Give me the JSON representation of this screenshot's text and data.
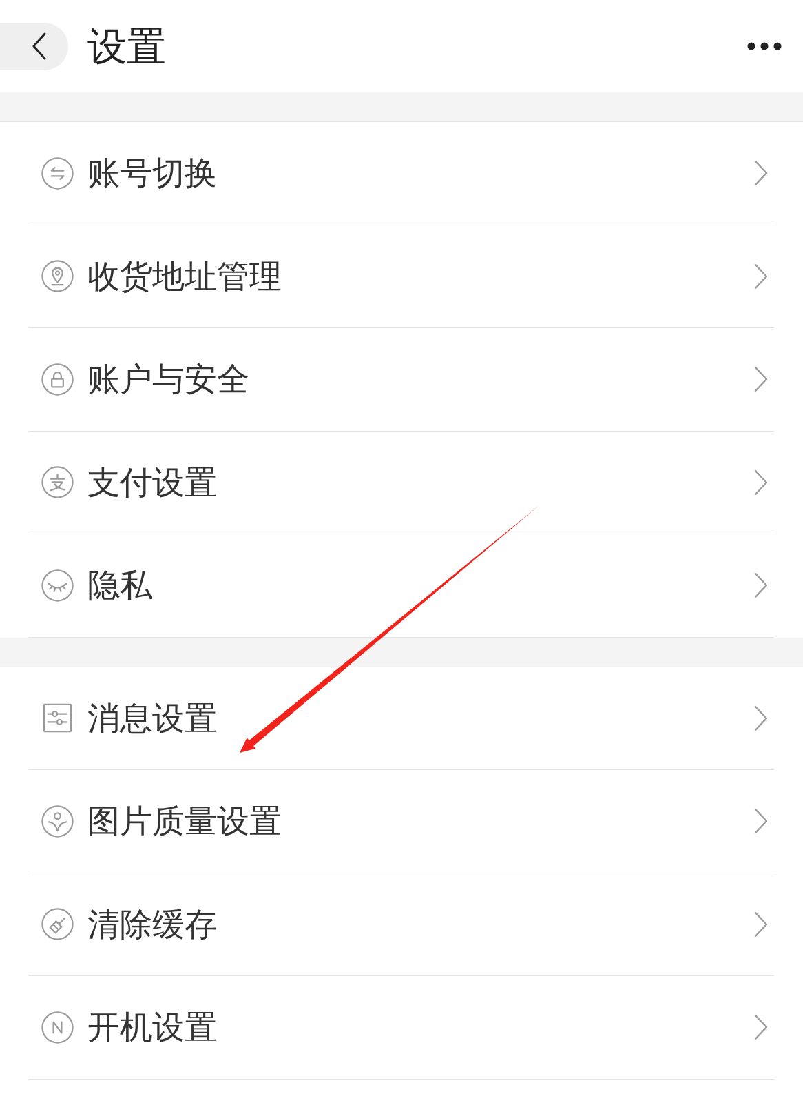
{
  "header": {
    "title": "设置"
  },
  "groups": [
    {
      "items": [
        {
          "label": "账号切换"
        },
        {
          "label": "收货地址管理"
        },
        {
          "label": "账户与安全"
        },
        {
          "label": "支付设置"
        },
        {
          "label": "隐私"
        }
      ]
    },
    {
      "items": [
        {
          "label": "消息设置"
        },
        {
          "label": "图片质量设置"
        },
        {
          "label": "清除缓存"
        },
        {
          "label": "开机设置"
        }
      ]
    }
  ]
}
